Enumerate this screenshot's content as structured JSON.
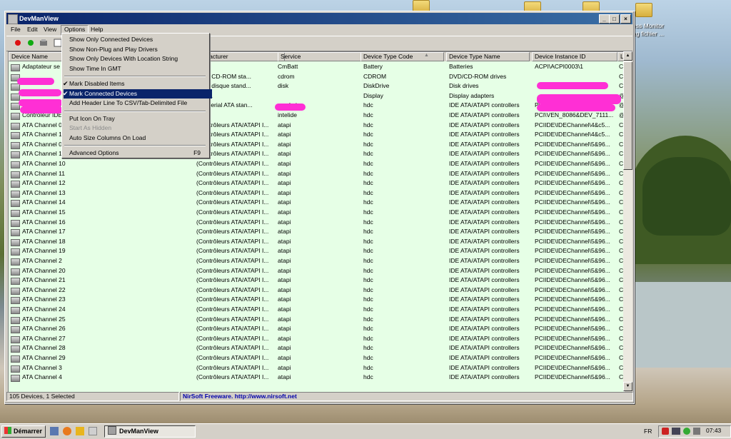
{
  "desktop": {
    "icon_label_line1": "ess Monitor",
    "icon_label_line2": "ag fichier ..."
  },
  "window": {
    "title": "DevManView",
    "btn_minimize": "_",
    "btn_maximize": "□",
    "btn_close": "×"
  },
  "menu": {
    "file": "File",
    "edit": "Edit",
    "view": "View",
    "options": "Options",
    "help": "Help"
  },
  "columns": {
    "device_name": "Device Name",
    "manufacturer": "ufacturer",
    "service": "Service",
    "device_type_code": "Device Type Code",
    "device_type_name": "Device Type Name",
    "device_instance_id": "Device Instance ID",
    "extra": "L"
  },
  "rows": [
    {
      "name": "Adaptateur se",
      "mfr": "oft",
      "service": "CmBatt",
      "code": "Battery",
      "type": "Batteries",
      "instance": "ACPI\\ACPI0003\\1",
      "extra": "C"
    },
    {
      "name": "",
      "mfr": "rs de CD-ROM sta...",
      "service": "cdrom",
      "code": "CDROM",
      "type": "DVD/CD-ROM drives",
      "instance": "",
      "extra": "C"
    },
    {
      "name": "",
      "mfr": "rs de disque stand...",
      "service": "disk",
      "code": "DiskDrive",
      "type": "Disk drives",
      "instance": "",
      "extra": "C"
    },
    {
      "name": "",
      "mfr": "e, Inc.",
      "service": "",
      "code": "Display",
      "type": "Display adapters",
      "instance": "",
      "extra": "@"
    },
    {
      "name": "Contrôleur Ser",
      "mfr": "eur Serial ATA stan...",
      "service": "msahci",
      "code": "hdc",
      "type": "IDE ATA/ATAPI controllers",
      "instance": "PCI\\VEN_15AD&DEV_07E...",
      "extra": "@"
    },
    {
      "name": "Contrôleur IDE",
      "mfr": "",
      "service": "intelide",
      "code": "hdc",
      "type": "IDE ATA/ATAPI controllers",
      "instance": "PCI\\VEN_8086&DEV_7111...",
      "extra": "@"
    },
    {
      "name": "ATA Channel 0",
      "mfr": "(Contrôleurs ATA/ATAPI I...",
      "service": "atapi",
      "code": "hdc",
      "type": "IDE ATA/ATAPI controllers",
      "instance": "PCIIDE\\IDEChannel\\4&c5...",
      "extra": "C"
    },
    {
      "name": "ATA Channel 1",
      "mfr": "(Contrôleurs ATA/ATAPI I...",
      "service": "atapi",
      "code": "hdc",
      "type": "IDE ATA/ATAPI controllers",
      "instance": "PCIIDE\\IDEChannel\\4&c5...",
      "extra": "C"
    },
    {
      "name": "ATA Channel 0",
      "mfr": "(Contrôleurs ATA/ATAPI I...",
      "service": "atapi",
      "code": "hdc",
      "type": "IDE ATA/ATAPI controllers",
      "instance": "PCIIDE\\IDEChannel\\5&96...",
      "extra": "C"
    },
    {
      "name": "ATA Channel 1",
      "mfr": "(Contrôleurs ATA/ATAPI I...",
      "service": "atapi",
      "code": "hdc",
      "type": "IDE ATA/ATAPI controllers",
      "instance": "PCIIDE\\IDEChannel\\5&96...",
      "extra": "C"
    },
    {
      "name": "ATA Channel 10",
      "mfr": "(Contrôleurs ATA/ATAPI I...",
      "service": "atapi",
      "code": "hdc",
      "type": "IDE ATA/ATAPI controllers",
      "instance": "PCIIDE\\IDEChannel\\5&96...",
      "extra": "C"
    },
    {
      "name": "ATA Channel 11",
      "mfr": "(Contrôleurs ATA/ATAPI I...",
      "service": "atapi",
      "code": "hdc",
      "type": "IDE ATA/ATAPI controllers",
      "instance": "PCIIDE\\IDEChannel\\5&96...",
      "extra": "C"
    },
    {
      "name": "ATA Channel 12",
      "mfr": "(Contrôleurs ATA/ATAPI I...",
      "service": "atapi",
      "code": "hdc",
      "type": "IDE ATA/ATAPI controllers",
      "instance": "PCIIDE\\IDEChannel\\5&96...",
      "extra": "C"
    },
    {
      "name": "ATA Channel 13",
      "mfr": "(Contrôleurs ATA/ATAPI I...",
      "service": "atapi",
      "code": "hdc",
      "type": "IDE ATA/ATAPI controllers",
      "instance": "PCIIDE\\IDEChannel\\5&96...",
      "extra": "C"
    },
    {
      "name": "ATA Channel 14",
      "mfr": "(Contrôleurs ATA/ATAPI I...",
      "service": "atapi",
      "code": "hdc",
      "type": "IDE ATA/ATAPI controllers",
      "instance": "PCIIDE\\IDEChannel\\5&96...",
      "extra": "C"
    },
    {
      "name": "ATA Channel 15",
      "mfr": "(Contrôleurs ATA/ATAPI I...",
      "service": "atapi",
      "code": "hdc",
      "type": "IDE ATA/ATAPI controllers",
      "instance": "PCIIDE\\IDEChannel\\5&96...",
      "extra": "C"
    },
    {
      "name": "ATA Channel 16",
      "mfr": "(Contrôleurs ATA/ATAPI I...",
      "service": "atapi",
      "code": "hdc",
      "type": "IDE ATA/ATAPI controllers",
      "instance": "PCIIDE\\IDEChannel\\5&96...",
      "extra": "C"
    },
    {
      "name": "ATA Channel 17",
      "mfr": "(Contrôleurs ATA/ATAPI I...",
      "service": "atapi",
      "code": "hdc",
      "type": "IDE ATA/ATAPI controllers",
      "instance": "PCIIDE\\IDEChannel\\5&96...",
      "extra": "C"
    },
    {
      "name": "ATA Channel 18",
      "mfr": "(Contrôleurs ATA/ATAPI I...",
      "service": "atapi",
      "code": "hdc",
      "type": "IDE ATA/ATAPI controllers",
      "instance": "PCIIDE\\IDEChannel\\5&96...",
      "extra": "C"
    },
    {
      "name": "ATA Channel 19",
      "mfr": "(Contrôleurs ATA/ATAPI I...",
      "service": "atapi",
      "code": "hdc",
      "type": "IDE ATA/ATAPI controllers",
      "instance": "PCIIDE\\IDEChannel\\5&96...",
      "extra": "C"
    },
    {
      "name": "ATA Channel 2",
      "mfr": "(Contrôleurs ATA/ATAPI I...",
      "service": "atapi",
      "code": "hdc",
      "type": "IDE ATA/ATAPI controllers",
      "instance": "PCIIDE\\IDEChannel\\5&96...",
      "extra": "C"
    },
    {
      "name": "ATA Channel 20",
      "mfr": "(Contrôleurs ATA/ATAPI I...",
      "service": "atapi",
      "code": "hdc",
      "type": "IDE ATA/ATAPI controllers",
      "instance": "PCIIDE\\IDEChannel\\5&96...",
      "extra": "C"
    },
    {
      "name": "ATA Channel 21",
      "mfr": "(Contrôleurs ATA/ATAPI I...",
      "service": "atapi",
      "code": "hdc",
      "type": "IDE ATA/ATAPI controllers",
      "instance": "PCIIDE\\IDEChannel\\5&96...",
      "extra": "C"
    },
    {
      "name": "ATA Channel 22",
      "mfr": "(Contrôleurs ATA/ATAPI I...",
      "service": "atapi",
      "code": "hdc",
      "type": "IDE ATA/ATAPI controllers",
      "instance": "PCIIDE\\IDEChannel\\5&96...",
      "extra": "C"
    },
    {
      "name": "ATA Channel 23",
      "mfr": "(Contrôleurs ATA/ATAPI I...",
      "service": "atapi",
      "code": "hdc",
      "type": "IDE ATA/ATAPI controllers",
      "instance": "PCIIDE\\IDEChannel\\5&96...",
      "extra": "C"
    },
    {
      "name": "ATA Channel 24",
      "mfr": "(Contrôleurs ATA/ATAPI I...",
      "service": "atapi",
      "code": "hdc",
      "type": "IDE ATA/ATAPI controllers",
      "instance": "PCIIDE\\IDEChannel\\5&96...",
      "extra": "C"
    },
    {
      "name": "ATA Channel 25",
      "mfr": "(Contrôleurs ATA/ATAPI I...",
      "service": "atapi",
      "code": "hdc",
      "type": "IDE ATA/ATAPI controllers",
      "instance": "PCIIDE\\IDEChannel\\5&96...",
      "extra": "C"
    },
    {
      "name": "ATA Channel 26",
      "mfr": "(Contrôleurs ATA/ATAPI I...",
      "service": "atapi",
      "code": "hdc",
      "type": "IDE ATA/ATAPI controllers",
      "instance": "PCIIDE\\IDEChannel\\5&96...",
      "extra": "C"
    },
    {
      "name": "ATA Channel 27",
      "mfr": "(Contrôleurs ATA/ATAPI I...",
      "service": "atapi",
      "code": "hdc",
      "type": "IDE ATA/ATAPI controllers",
      "instance": "PCIIDE\\IDEChannel\\5&96...",
      "extra": "C"
    },
    {
      "name": "ATA Channel 28",
      "mfr": "(Contrôleurs ATA/ATAPI I...",
      "service": "atapi",
      "code": "hdc",
      "type": "IDE ATA/ATAPI controllers",
      "instance": "PCIIDE\\IDEChannel\\5&96...",
      "extra": "C"
    },
    {
      "name": "ATA Channel 29",
      "mfr": "(Contrôleurs ATA/ATAPI I...",
      "service": "atapi",
      "code": "hdc",
      "type": "IDE ATA/ATAPI controllers",
      "instance": "PCIIDE\\IDEChannel\\5&96...",
      "extra": "C"
    },
    {
      "name": "ATA Channel 3",
      "mfr": "(Contrôleurs ATA/ATAPI I...",
      "service": "atapi",
      "code": "hdc",
      "type": "IDE ATA/ATAPI controllers",
      "instance": "PCIIDE\\IDEChannel\\5&96...",
      "extra": "C"
    },
    {
      "name": "ATA Channel 4",
      "mfr": "(Contrôleurs ATA/ATAPI I...",
      "service": "atapi",
      "code": "hdc",
      "type": "IDE ATA/ATAPI controllers",
      "instance": "PCIIDE\\IDEChannel\\5&96...",
      "extra": "C"
    }
  ],
  "options_menu": [
    {
      "label": "Show Only Connected Devices",
      "checked": false,
      "disabled": false,
      "selected": false,
      "shortcut": ""
    },
    {
      "label": "Show Non-Plug and Play Drivers",
      "checked": false,
      "disabled": false,
      "selected": false,
      "shortcut": ""
    },
    {
      "label": "Show Only Devices With Location String",
      "checked": false,
      "disabled": false,
      "selected": false,
      "shortcut": ""
    },
    {
      "label": "Show Time In GMT",
      "checked": false,
      "disabled": false,
      "selected": false,
      "shortcut": ""
    },
    {
      "separator": true
    },
    {
      "label": "Mark Disabled Items",
      "checked": true,
      "disabled": false,
      "selected": false,
      "shortcut": ""
    },
    {
      "label": "Mark Connected Devices",
      "checked": true,
      "disabled": false,
      "selected": true,
      "shortcut": ""
    },
    {
      "label": "Add Header Line To CSV/Tab-Delimited File",
      "checked": false,
      "disabled": false,
      "selected": false,
      "shortcut": ""
    },
    {
      "separator": true
    },
    {
      "label": "Put Icon On Tray",
      "checked": false,
      "disabled": false,
      "selected": false,
      "shortcut": ""
    },
    {
      "label": "Start As Hidden",
      "checked": false,
      "disabled": true,
      "selected": false,
      "shortcut": ""
    },
    {
      "label": "Auto Size Columns On Load",
      "checked": false,
      "disabled": false,
      "selected": false,
      "shortcut": ""
    },
    {
      "separator": true
    },
    {
      "label": "Advanced Options",
      "checked": false,
      "disabled": false,
      "selected": false,
      "shortcut": "F9"
    }
  ],
  "status": {
    "count": "105 Devices, 1 Selected",
    "credit": "NirSoft Freeware.  http://www.nirsoft.net"
  },
  "taskbar": {
    "start": "Démarrer",
    "task": "DevManView",
    "lang": "FR",
    "clock": "07:43"
  },
  "colors": {
    "list_bg": "#e6ffe6",
    "selection": "#0a246a",
    "title_bar": "#0a246a",
    "redaction": "#ff2fd5",
    "status_link": "#0000aa"
  }
}
